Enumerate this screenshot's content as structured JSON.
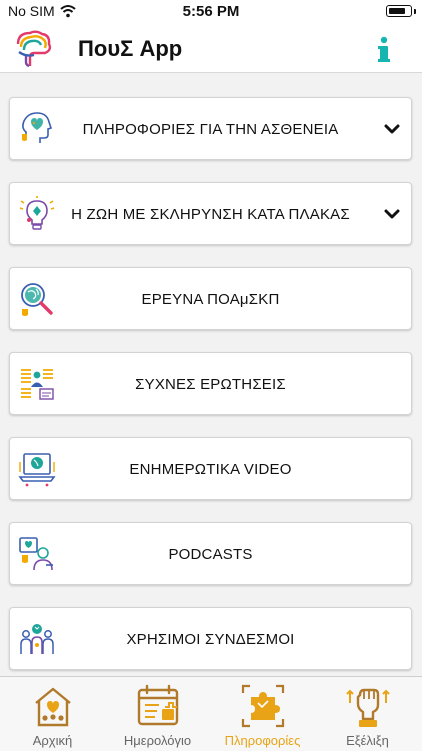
{
  "status": {
    "carrier": "No SIM",
    "time": "5:56 PM"
  },
  "app": {
    "title": "ΠουΣ App"
  },
  "colors": {
    "accent": "#e8a317",
    "info": "#17b5b0",
    "icon_blue": "#3a5fb0",
    "icon_teal": "#1fa69a"
  },
  "menu": [
    {
      "label": "ΠΛΗΡΟΦΟΡΙΕΣ ΓΙΑ ΤΗΝ ΑΣΘΕΝΕΙΑ",
      "icon": "brain-heart-icon",
      "expandable": true
    },
    {
      "label": "Η ΖΩΗ ΜΕ ΣΚΛΗΡΥΝΣΗ ΚΑΤΑ ΠΛΑΚΑΣ",
      "icon": "lightbulb-icon",
      "expandable": true
    },
    {
      "label": "ΕΡΕΥΝΑ ΠΟΑμΣΚΠ",
      "icon": "magnifier-globe-icon",
      "expandable": false
    },
    {
      "label": "ΣΥΧΝΕΣ ΕΡΩΤΗΣΕΙΣ",
      "icon": "faq-list-icon",
      "expandable": false
    },
    {
      "label": "ΕΝΗΜΕΡΩΤΙΚΑ VIDEO",
      "icon": "video-laptop-icon",
      "expandable": false
    },
    {
      "label": "PODCASTS",
      "icon": "podcast-icon",
      "expandable": false
    },
    {
      "label": "ΧΡΗΣΙΜΟΙ ΣΥΝΔΕΣΜΟΙ",
      "icon": "people-links-icon",
      "expandable": false
    }
  ],
  "tabs": [
    {
      "label": "Αρχική",
      "icon": "home-icon",
      "active": false
    },
    {
      "label": "Ημερολόγιο",
      "icon": "calendar-icon",
      "active": false
    },
    {
      "label": "Πληροφορίες",
      "icon": "puzzle-icon",
      "active": true
    },
    {
      "label": "Εξέλιξη",
      "icon": "fist-progress-icon",
      "active": false
    }
  ]
}
